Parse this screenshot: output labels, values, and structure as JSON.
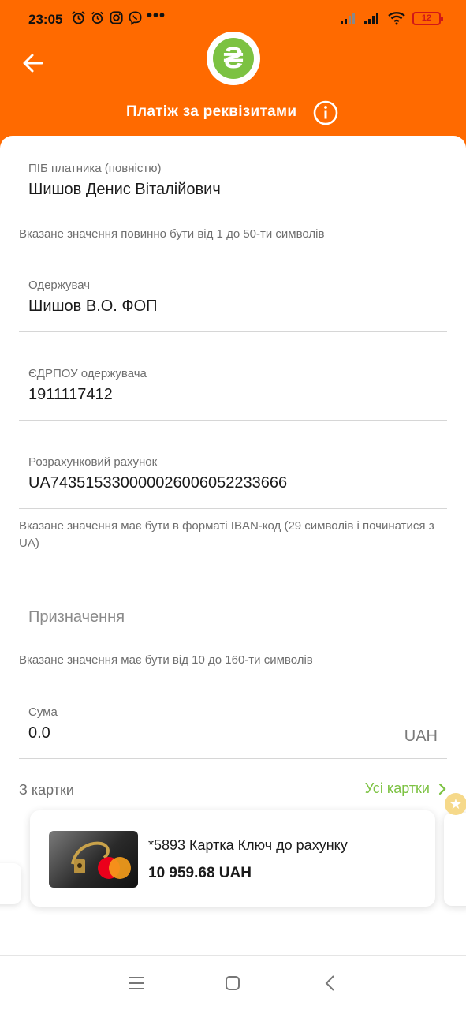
{
  "status_bar": {
    "time": "23:05",
    "dots": "•••",
    "battery": "12",
    "icons": [
      "alarm-icon",
      "alarm-icon",
      "instagram-icon",
      "viber-icon",
      "signal-icon",
      "signal-icon",
      "wifi-icon",
      "battery-icon"
    ]
  },
  "header": {
    "logo_symbol": "₴",
    "title": "Платіж за реквізитами",
    "icons": [
      "back-arrow-icon",
      "info-icon"
    ]
  },
  "form": {
    "payer": {
      "label": "ПІБ платника (повністю)",
      "value": "Шишов Денис Віталійович",
      "hint": "Вказане значення повинно бути від 1 до 50-ти символів"
    },
    "recipient": {
      "label": "Одержувач",
      "value": "Шишов В.О. ФОП"
    },
    "edrpou": {
      "label": "ЄДРПОУ одержувача",
      "value": "1911117412"
    },
    "account": {
      "label": "Розрахунковий рахунок",
      "value": "UA743515330000026006052233666",
      "hint": "Вказане значення має бути в форматі IBAN-код (29 символів і починатися з UA)"
    },
    "purpose": {
      "placeholder": "Призначення",
      "hint": "Вказане значення має бути від 10 до 160-ти символів"
    },
    "amount": {
      "label": "Сума",
      "value": "0.0",
      "currency": "UAH"
    }
  },
  "cards": {
    "section_label": "З картки",
    "all_cards_label": "Усі картки",
    "selected": {
      "name": "*5893 Картка Ключ до рахунку",
      "balance": "10 959.68 UAH"
    }
  },
  "colors": {
    "brand_orange": "#ff6a00",
    "accent_green": "#7cc242",
    "battery_red": "#d01818"
  }
}
